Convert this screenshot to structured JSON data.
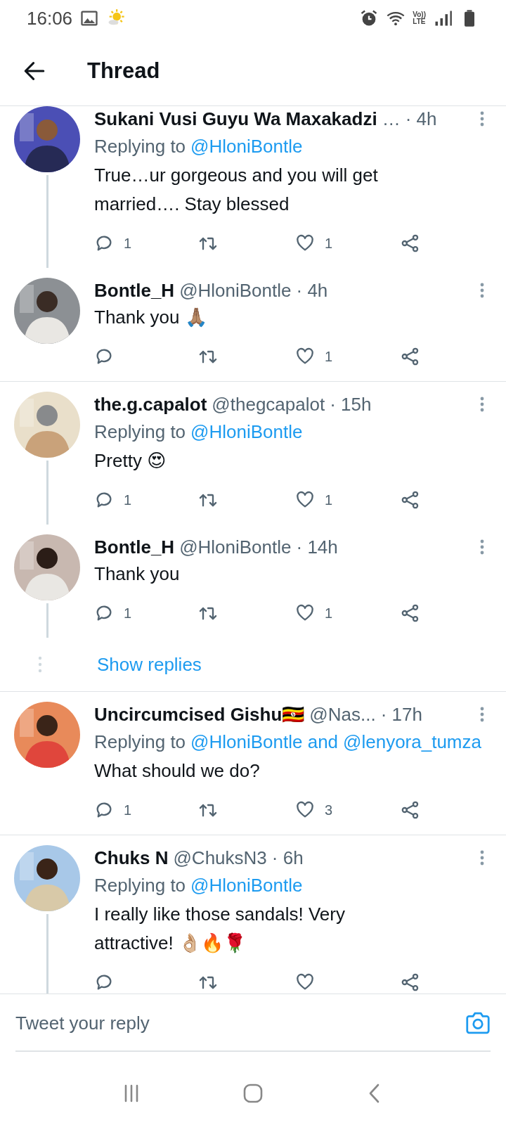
{
  "status_bar": {
    "time": "16:06",
    "network_top": "Vo))",
    "network_bottom": "LTE"
  },
  "header": {
    "title": "Thread"
  },
  "tweets": [
    {
      "name": "Sukani Vusi Guyu Wa Maxakadzi",
      "handle": "…",
      "time": "· 4h",
      "replying_label": "Replying to",
      "mentions": [
        "@HloniBontle"
      ],
      "text": "True…ur gorgeous and you will get married…. Stay blessed",
      "reply_count": "1",
      "like_count": "1",
      "thread_line": true
    },
    {
      "name": "Bontle_H",
      "handle": "@HloniBontle",
      "time": "· 4h",
      "text": "Thank you 🙏🏽",
      "like_count": "1",
      "thread_line": false
    },
    {
      "name": "the.g.capalot",
      "handle": "@thegcapalot",
      "time": "· 15h",
      "replying_label": "Replying to",
      "mentions": [
        "@HloniBontle"
      ],
      "text": "Pretty 😍",
      "reply_count": "1",
      "like_count": "1",
      "thread_line": true
    },
    {
      "name": "Bontle_H",
      "handle": "@HloniBontle",
      "time": "· 14h",
      "text": "Thank you",
      "reply_count": "1",
      "like_count": "1",
      "thread_line": true,
      "show_replies": "Show replies"
    },
    {
      "name": "Uncircumcised Gishu🇺🇬",
      "handle": "@Nas...",
      "time": "· 17h",
      "replying_label": "Replying to",
      "mentions": [
        "@HloniBontle and",
        "@lenyora_tumza"
      ],
      "text": "What should we do?",
      "reply_count": "1",
      "like_count": "3",
      "thread_line": false
    },
    {
      "name": "Chuks N",
      "handle": "@ChuksN3",
      "time": "· 6h",
      "replying_label": "Replying to",
      "mentions": [
        "@HloniBontle"
      ],
      "text": "I really like those sandals! Very attractive! 👌🏼🔥🌹",
      "thread_line": true
    }
  ],
  "reply_bar": {
    "placeholder": "Tweet your reply"
  }
}
